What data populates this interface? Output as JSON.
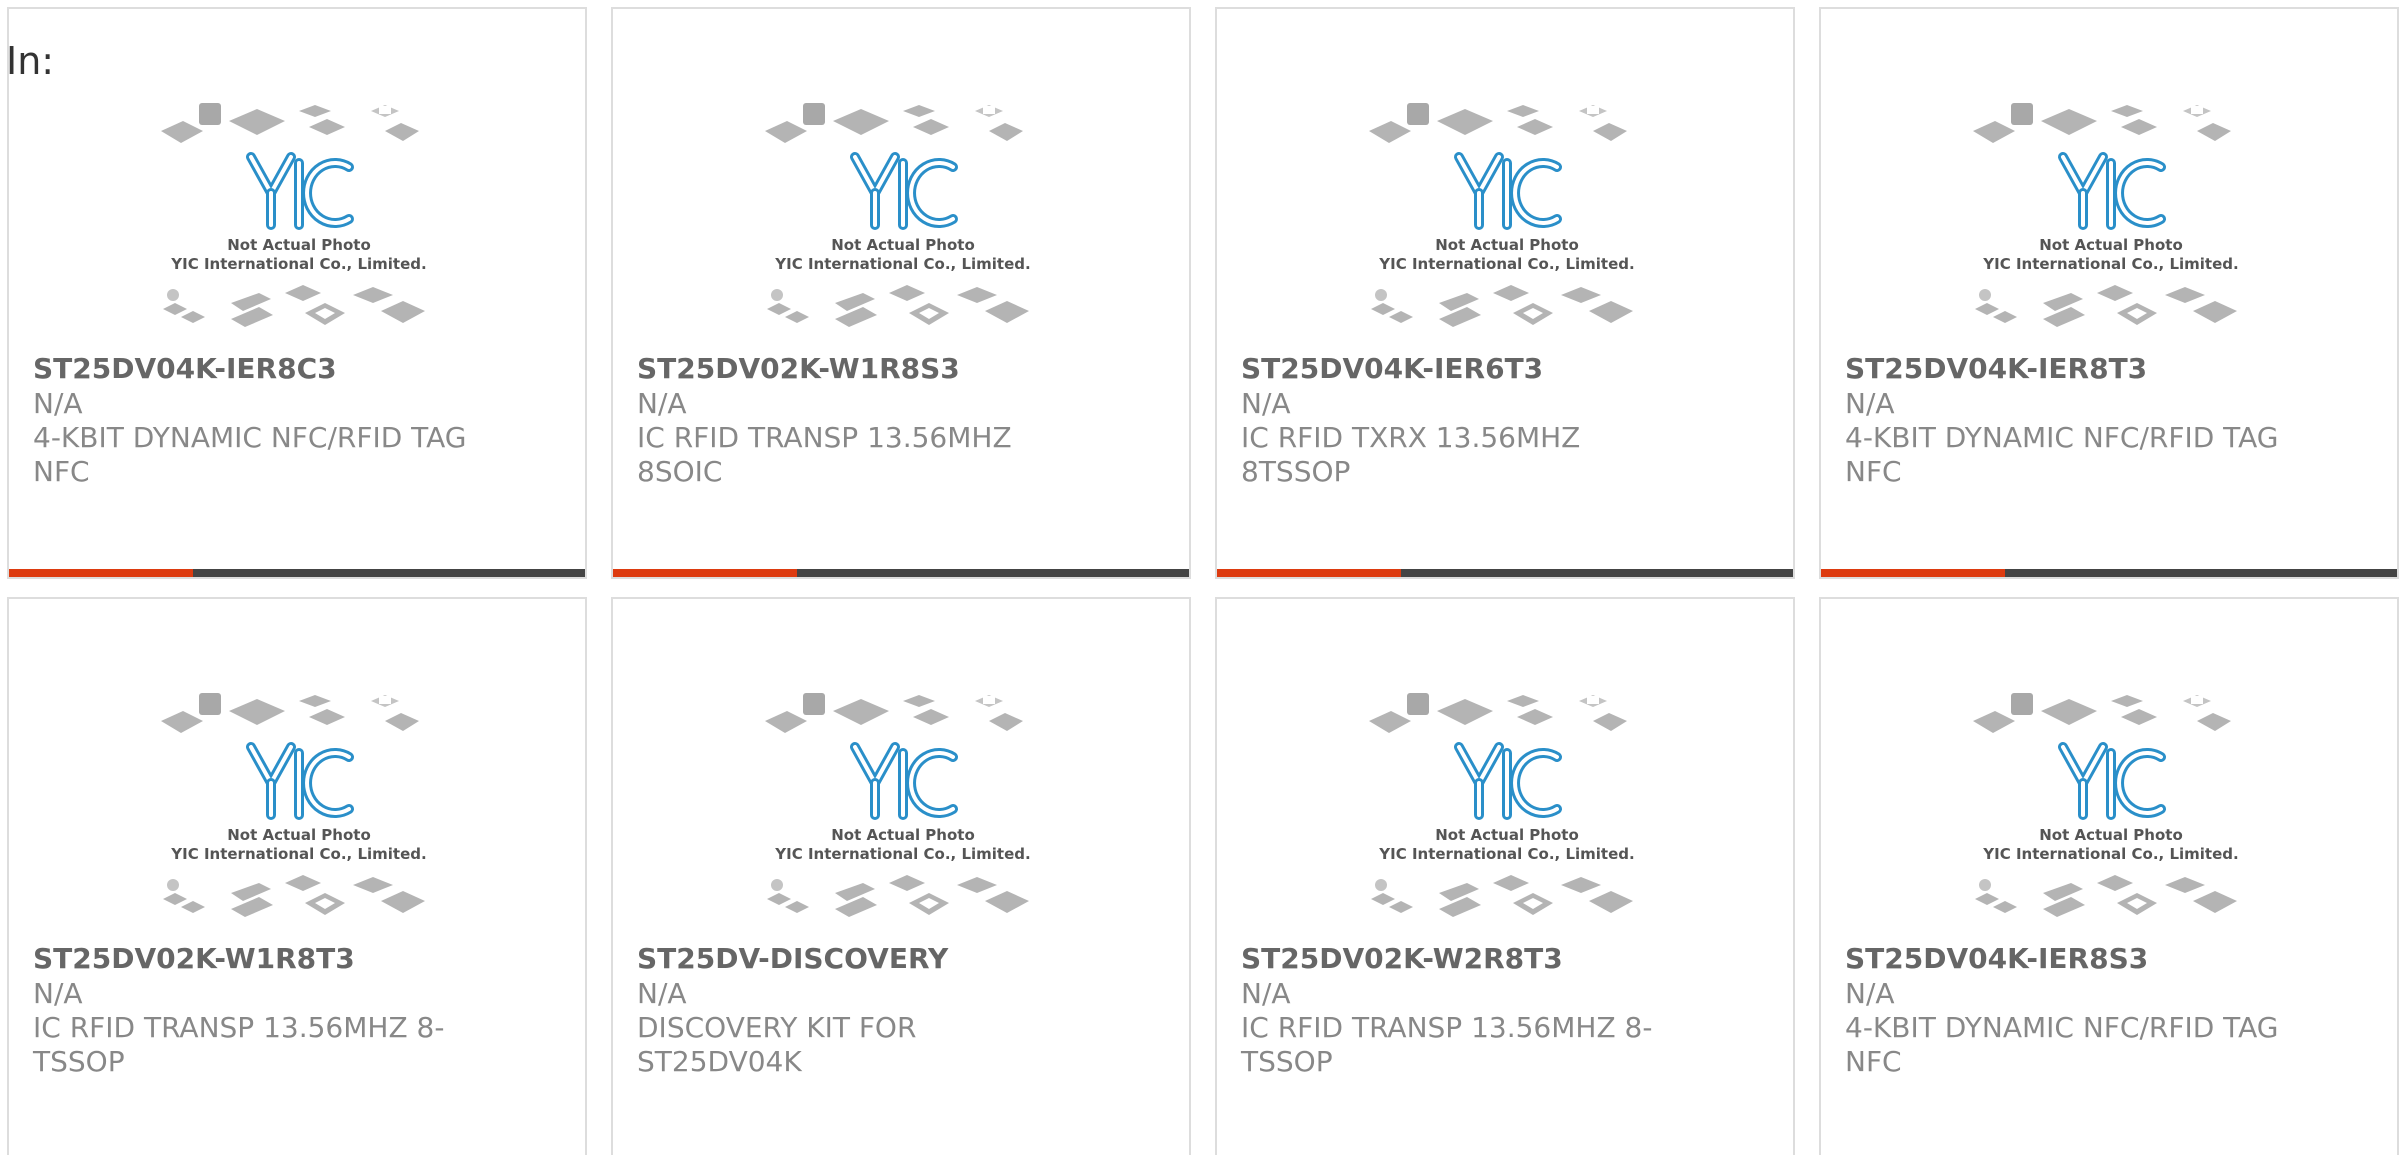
{
  "filter": {
    "label": "In:"
  },
  "photo": {
    "logo_text": "YIC",
    "caption_line1": "Not Actual Photo",
    "caption_line2": "YIC International Co., Limited."
  },
  "colors": {
    "accent": "#dd3b10",
    "bar": "#444444",
    "logo_blue": "#2a8fc9"
  },
  "products": [
    {
      "part": "ST25DV04K-IER8C3",
      "manufacturer": "N/A",
      "description": "4-KBIT DYNAMIC NFC/RFID TAG NFC",
      "accent_bar": true
    },
    {
      "part": "ST25DV02K-W1R8S3",
      "manufacturer": "N/A",
      "description": "IC RFID TRANSP 13.56MHZ 8SOIC",
      "accent_bar": true
    },
    {
      "part": "ST25DV04K-IER6T3",
      "manufacturer": "N/A",
      "description": "IC RFID TXRX 13.56MHZ 8TSSOP",
      "accent_bar": true
    },
    {
      "part": "ST25DV04K-IER8T3",
      "manufacturer": "N/A",
      "description": "4-KBIT DYNAMIC NFC/RFID TAG NFC",
      "accent_bar": true
    },
    {
      "part": "ST25DV02K-W1R8T3",
      "manufacturer": "N/A",
      "description": "IC RFID TRANSP 13.56MHZ 8-TSSOP",
      "accent_bar": false
    },
    {
      "part": "ST25DV-DISCOVERY",
      "manufacturer": "N/A",
      "description": "DISCOVERY KIT FOR ST25DV04K",
      "accent_bar": false
    },
    {
      "part": "ST25DV02K-W2R8T3",
      "manufacturer": "N/A",
      "description": "IC RFID TRANSP 13.56MHZ 8-TSSOP",
      "accent_bar": false
    },
    {
      "part": "ST25DV04K-IER8S3",
      "manufacturer": "N/A",
      "description": "4-KBIT DYNAMIC NFC/RFID TAG NFC",
      "accent_bar": false
    }
  ]
}
